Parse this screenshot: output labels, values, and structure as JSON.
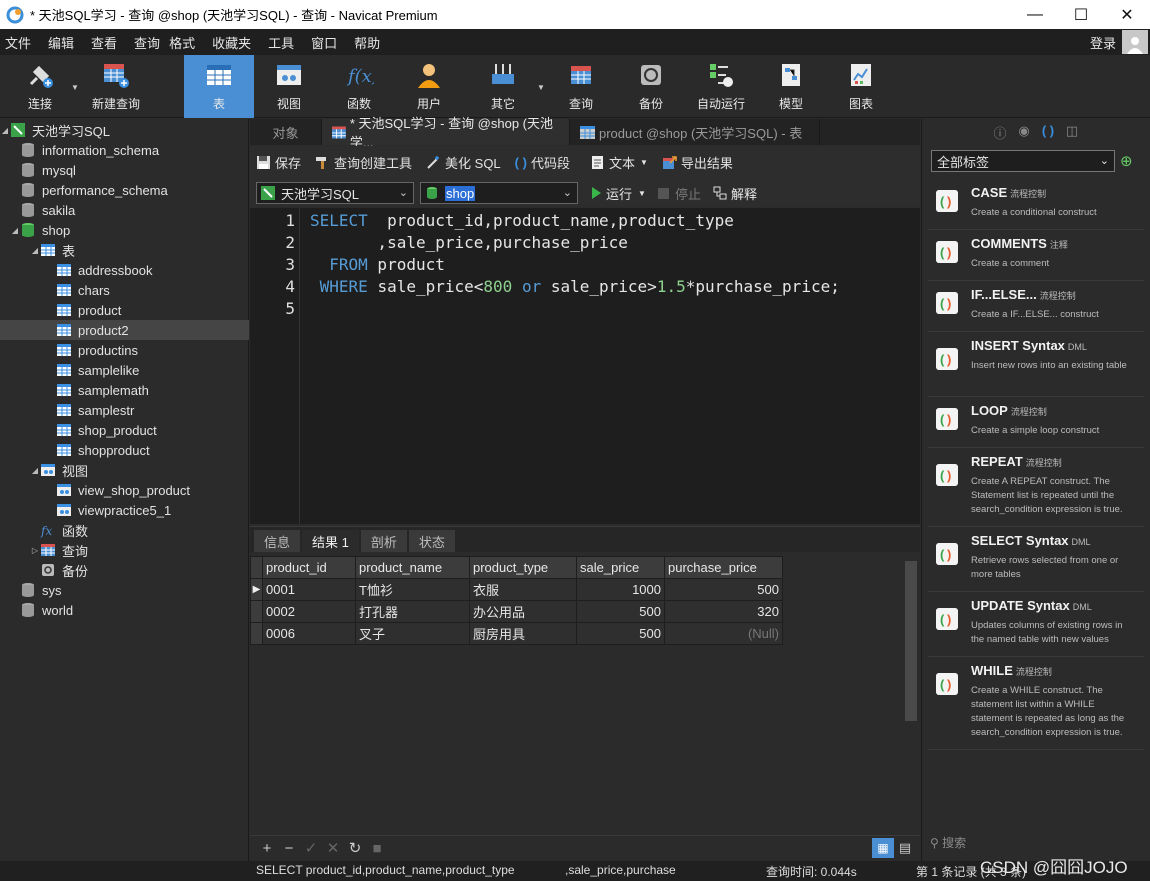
{
  "window": {
    "title": "* 天池SQL学习 - 查询 @shop (天池学习SQL) - 查询 - Navicat Premium"
  },
  "menu": [
    "文件",
    "编辑",
    "查看",
    "查询",
    "格式",
    "收藏夹",
    "工具",
    "窗口",
    "帮助"
  ],
  "login": "登录",
  "toolbar": {
    "connect": "连接",
    "new_query": "新建查询",
    "table": "表",
    "view": "视图",
    "function": "函数",
    "user": "用户",
    "other": "其它",
    "query": "查询",
    "backup": "备份",
    "auto_run": "自动运行",
    "model": "模型",
    "chart": "图表"
  },
  "tree": {
    "connection": "天池学习SQL",
    "databases": [
      "information_schema",
      "mysql",
      "performance_schema",
      "sakila",
      "shop",
      "sys",
      "world"
    ],
    "tables_label": "表",
    "tables": [
      "addressbook",
      "chars",
      "product",
      "product2",
      "productins",
      "samplelike",
      "samplemath",
      "samplestr",
      "shop_product",
      "shopproduct"
    ],
    "views_label": "视图",
    "views": [
      "view_shop_product",
      "viewpractice5_1"
    ],
    "functions_label": "函数",
    "queries_label": "查询",
    "backup_label": "备份"
  },
  "tabs": {
    "objects": "对象",
    "query_tab": "* 天池SQL学习 - 查询 @shop (天池学...",
    "product_tab": "product @shop (天池学习SQL) - 表"
  },
  "query_toolbar": {
    "save": "保存",
    "builder": "查询创建工具",
    "beautify": "美化 SQL",
    "snippet": "代码段",
    "text": "文本",
    "export": "导出结果"
  },
  "selectors": {
    "connection": "天池学习SQL",
    "database": "shop",
    "run": "运行",
    "stop": "停止",
    "explain": "解释"
  },
  "editor": {
    "line_numbers": [
      "1",
      "2",
      "3",
      "4",
      "5"
    ]
  },
  "result_tabs": [
    "信息",
    "结果 1",
    "剖析",
    "状态"
  ],
  "result": {
    "columns": [
      "product_id",
      "product_name",
      "product_type",
      "sale_price",
      "purchase_price"
    ],
    "rows": [
      [
        "0001",
        "T恤衫",
        "衣服",
        "1000",
        "500"
      ],
      [
        "0002",
        "打孔器",
        "办公用品",
        "500",
        "320"
      ],
      [
        "0006",
        "叉子",
        "厨房用具",
        "500",
        "(Null)"
      ]
    ]
  },
  "right_panel": {
    "tag_filter": "全部标签",
    "snippets": [
      {
        "name": "CASE",
        "tag": "流程控制",
        "desc": "Create a conditional construct"
      },
      {
        "name": "COMMENTS",
        "tag": "注释",
        "desc": "Create a comment"
      },
      {
        "name": "IF...ELSE...",
        "tag": "流程控制",
        "desc": "Create a IF...ELSE... construct"
      },
      {
        "name": "INSERT Syntax",
        "tag": "DML",
        "desc": "Insert new rows into an existing table"
      },
      {
        "name": "LOOP",
        "tag": "流程控制",
        "desc": "Create a simple loop construct"
      },
      {
        "name": "REPEAT",
        "tag": "流程控制",
        "desc": "Create A REPEAT construct. The Statement list is repeated until the search_condition expression is true."
      },
      {
        "name": "SELECT Syntax",
        "tag": "DML",
        "desc": "Retrieve rows selected from one or more tables"
      },
      {
        "name": "UPDATE Syntax",
        "tag": "DML",
        "desc": "Updates columns of existing rows in the named table with new values"
      },
      {
        "name": "WHILE",
        "tag": "流程控制",
        "desc": "Create a WHILE construct. The statement list within a WHILE statement is repeated as long as the search_condition expression is true."
      }
    ],
    "search": "搜索"
  },
  "status": {
    "sql": "SELECT  product_id,product_name,product_type",
    "sql_cont": ",sale_price,purchase",
    "time": "查询时间: 0.044s",
    "records": "第 1 条记录 (共 3 条)",
    "watermark": "CSDN @囧囧JOJO"
  }
}
